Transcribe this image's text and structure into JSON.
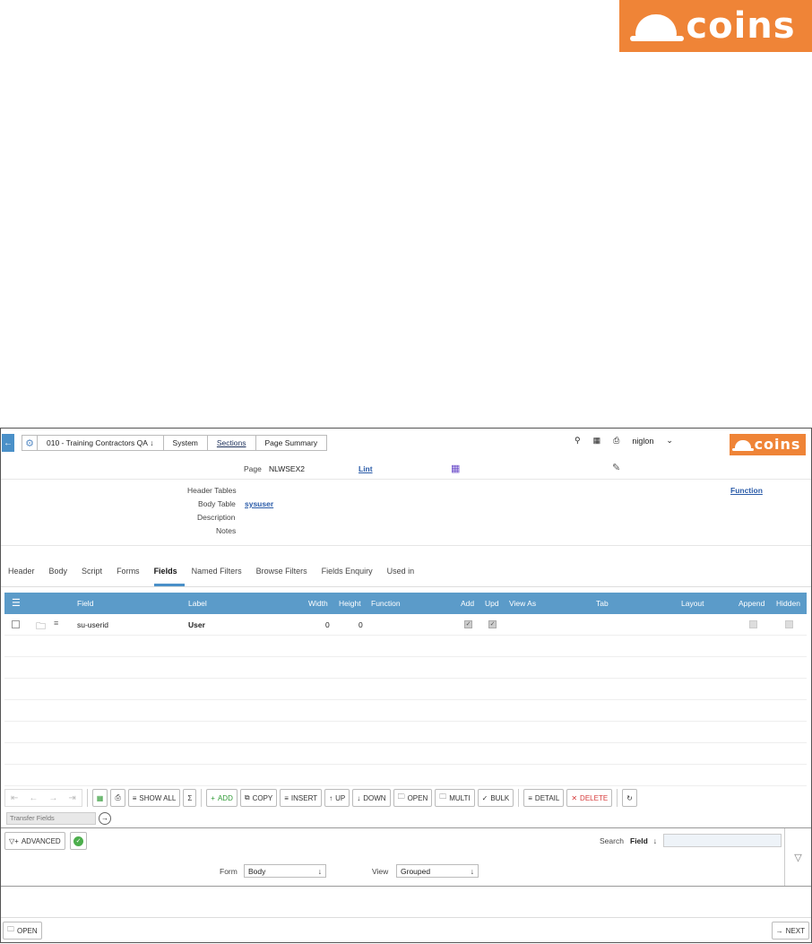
{
  "brand": {
    "logo_text": "coins"
  },
  "topbar": {
    "breadcrumbs": [
      "010 - Training Contractors QA",
      "System",
      "Sections",
      "Page Summary"
    ],
    "user": "niglon"
  },
  "page_row": {
    "page_label": "Page",
    "page_value": "NLWSEX2",
    "lint": "Lint"
  },
  "props": {
    "header_tables_label": "Header Tables",
    "body_table_label": "Body Table",
    "body_table_value": "sysuser",
    "description_label": "Description",
    "notes_label": "Notes",
    "function_link": "Function"
  },
  "tabs": [
    "Header",
    "Body",
    "Script",
    "Forms",
    "Fields",
    "Named Filters",
    "Browse Filters",
    "Fields Enquiry",
    "Used in"
  ],
  "active_tab": "Fields",
  "grid": {
    "columns": {
      "field": "Field",
      "label": "Label",
      "width": "Width",
      "height": "Height",
      "function": "Function",
      "add": "Add",
      "upd": "Upd",
      "view_as": "View As",
      "tab": "Tab",
      "layout": "Layout",
      "append": "Append",
      "hidden": "Hidden"
    },
    "rows": [
      {
        "field": "su-userid",
        "label": "User",
        "width": "0",
        "height": "0",
        "add": true,
        "upd": true
      }
    ]
  },
  "toolbar": {
    "show_all": "SHOW ALL",
    "sigma": "Σ",
    "add": "ADD",
    "copy": "COPY",
    "insert": "INSERT",
    "up": "UP",
    "down": "DOWN",
    "open": "OPEN",
    "multi": "MULTI",
    "bulk": "BULK",
    "detail": "DETAIL",
    "delete": "DELETE",
    "transfer_placeholder": "Transfer Fields"
  },
  "filter": {
    "advanced": "ADVANCED",
    "search_label": "Search",
    "search_field": "Field",
    "form_label": "Form",
    "form_value": "Body",
    "view_label": "View",
    "view_value": "Grouped"
  },
  "footer": {
    "open": "OPEN",
    "next": "NEXT"
  }
}
